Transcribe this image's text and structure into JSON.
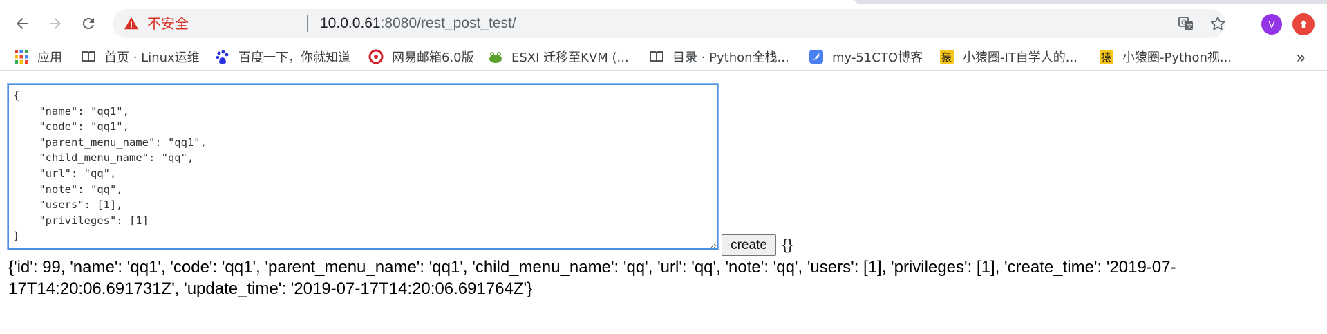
{
  "browser": {
    "security_label": "不安全",
    "url_host": "10.0.0.61",
    "url_rest": ":8080/rest_post_test/",
    "profile_initial": "V"
  },
  "bookmarks": [
    {
      "label": "应用",
      "icon": "apps-grid-icon"
    },
    {
      "label": "首页 · Linux运维",
      "icon": "book-icon"
    },
    {
      "label": "百度一下，你就知道",
      "icon": "baidu-paw-icon"
    },
    {
      "label": "网易邮箱6.0版",
      "icon": "netease-mail-icon"
    },
    {
      "label": "ESXI 迁移至KVM (...",
      "icon": "frog-icon"
    },
    {
      "label": "目录 · Python全栈...",
      "icon": "book-icon"
    },
    {
      "label": "my-51CTO博客",
      "icon": "feather-icon"
    },
    {
      "label": "小猿圈-IT自学人的...",
      "icon": "yuan-icon"
    },
    {
      "label": "小猿圈-Python视...",
      "icon": "yuan-icon"
    }
  ],
  "bookmarks_more": "»",
  "form": {
    "json_text": "{\n    \"name\": \"qq1\",\n    \"code\": \"qq1\",\n    \"parent_menu_name\": \"qq1\",\n    \"child_menu_name\": \"qq\",\n    \"url\": \"qq\",\n    \"note\": \"qq\",\n    \"users\": [1],\n    \"privileges\": [1]\n}",
    "create_label": "create",
    "inline_response": "{}"
  },
  "result_text": "{'id': 99, 'name': 'qq1', 'code': 'qq1', 'parent_menu_name': 'qq1', 'child_menu_name': 'qq', 'url': 'qq', 'note': 'qq', 'users': [1], 'privileges': [1], 'create_time': '2019-07-17T14:20:06.691731Z', 'update_time': '2019-07-17T14:20:06.691764Z'}",
  "colors": {
    "insecure": "#d93025",
    "avatar": "#9334e6",
    "extension": "#e8453c",
    "focus_border": "#4a90e2"
  }
}
